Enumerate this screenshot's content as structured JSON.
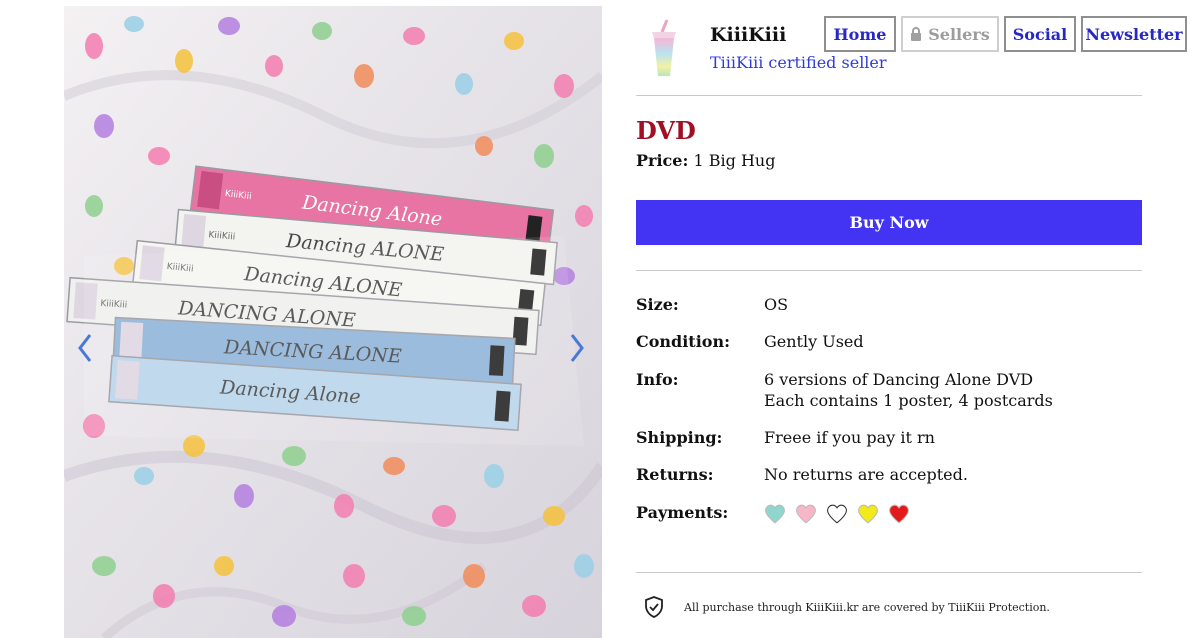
{
  "seller": {
    "name": "KiiiKiii",
    "certification": "TiiiKiii certified seller"
  },
  "nav": [
    {
      "label": "Home",
      "locked": false
    },
    {
      "label": "Sellers",
      "locked": true
    },
    {
      "label": "Social",
      "locked": false
    },
    {
      "label": "Newsletter",
      "locked": false
    }
  ],
  "product": {
    "title": "DVD",
    "price_label": "Price:",
    "price_value": "1 Big Hug",
    "buy_label": "Buy Now"
  },
  "specs": {
    "size": {
      "label": "Size:",
      "value": "OS"
    },
    "condition": {
      "label": "Condition:",
      "value": "Gently Used"
    },
    "info": {
      "label": "Info:",
      "line1": "6 versions of Dancing Alone DVD",
      "line2": "Each contains 1 poster, 4 postcards"
    },
    "shipping": {
      "label": "Shipping:",
      "value": "Freee if you pay it rn"
    },
    "returns": {
      "label": "Returns:",
      "value": "No returns are accepted."
    },
    "payments": {
      "label": "Payments:",
      "methods": [
        {
          "icon": "teal-heart-icon",
          "color": "#8fd6cf"
        },
        {
          "icon": "pink-heart-icon",
          "color": "#f7b7c9"
        },
        {
          "icon": "white-heart-icon",
          "color": "#ffffff"
        },
        {
          "icon": "yellow-heart-icon",
          "color": "#f3ea1a"
        },
        {
          "icon": "red-heart-icon",
          "color": "#e21a1a"
        }
      ]
    }
  },
  "protection": {
    "text": "All purchase through KiiiKiii.kr are covered by TiiiKiii Protection."
  },
  "photo": {
    "dvd_spines": [
      {
        "label": "Dancing Alone",
        "brand": "KiiiKiii",
        "color": "#e774a2"
      },
      {
        "label": "Dancing ALONE",
        "brand": "KiiiKiii",
        "color": "#f3f3ef"
      },
      {
        "label": "Dancing ALONE",
        "brand": "KiiiKiii",
        "color": "#f5f5f2"
      },
      {
        "label": "DANCING ALONE",
        "brand": "KiiiKiii",
        "color": "#f0f0ee"
      },
      {
        "label": "DANCING ALONE",
        "brand": "",
        "color": "#8fb3d9"
      },
      {
        "label": "Dancing Alone",
        "brand": "",
        "color": "#b8d4ea"
      }
    ]
  }
}
